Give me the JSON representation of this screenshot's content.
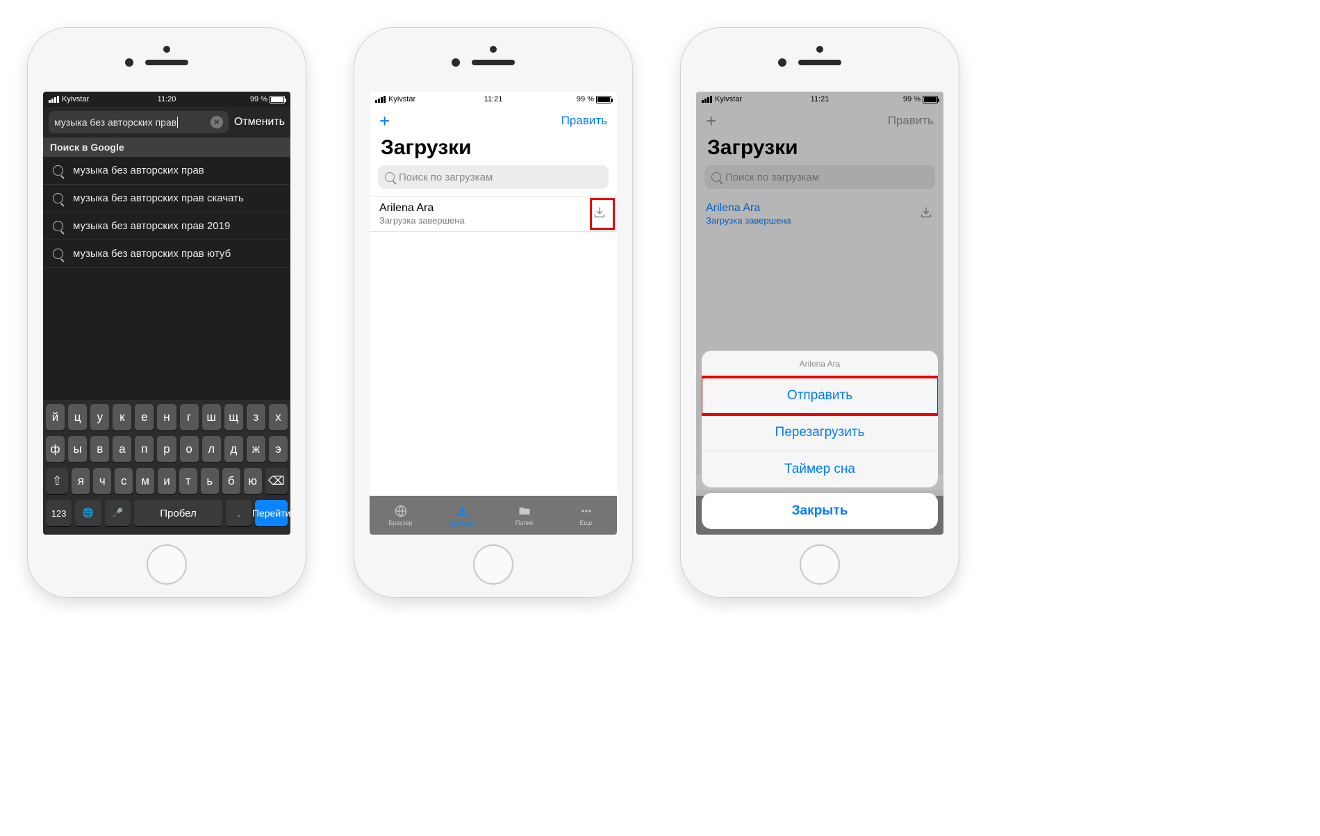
{
  "status": {
    "carrier": "Kyivstar",
    "battery_pct": "99 %"
  },
  "phone1": {
    "time": "11:20",
    "search_value": "музыка без авторских прав",
    "cancel": "Отменить",
    "section": "Поиск в Google",
    "suggestions": [
      "музыка без авторских прав",
      "музыка без авторских прав скачать",
      "музыка без авторских прав 2019",
      "музыка без авторских прав ютуб"
    ],
    "keyboard": {
      "row1": [
        "й",
        "ц",
        "у",
        "к",
        "е",
        "н",
        "г",
        "ш",
        "щ",
        "з",
        "х"
      ],
      "row2": [
        "ф",
        "ы",
        "в",
        "а",
        "п",
        "р",
        "о",
        "л",
        "д",
        "ж",
        "э"
      ],
      "row3": [
        "я",
        "ч",
        "с",
        "м",
        "и",
        "т",
        "ь",
        "б",
        "ю"
      ],
      "shift": "⇧",
      "backspace": "⌫",
      "numbers": "123",
      "globe": "🌐",
      "mic": "🎤",
      "space": "Пробел",
      "period": ".",
      "go": "Перейти"
    }
  },
  "phone2": {
    "time": "11:21",
    "edit": "Править",
    "title": "Загрузки",
    "search_ph": "Поиск по загрузкам",
    "item": {
      "title": "Arilena Ara",
      "subtitle": "Загрузка завершена"
    },
    "tabs": {
      "browser": "Браузер",
      "downloads": "Загрузки",
      "folders": "Папки",
      "more": "Еще"
    }
  },
  "phone3": {
    "time": "11:21",
    "edit": "Править",
    "title": "Загрузки",
    "search_ph": "Поиск по загрузкам",
    "item": {
      "title": "Arilena Ara",
      "subtitle": "Загрузка завершена"
    },
    "sheet": {
      "header": "Arilena Ara",
      "send": "Отправить",
      "reload": "Перезагрузить",
      "timer": "Таймер сна",
      "close": "Закрыть",
      "ghost": "Arilena Ara"
    }
  }
}
